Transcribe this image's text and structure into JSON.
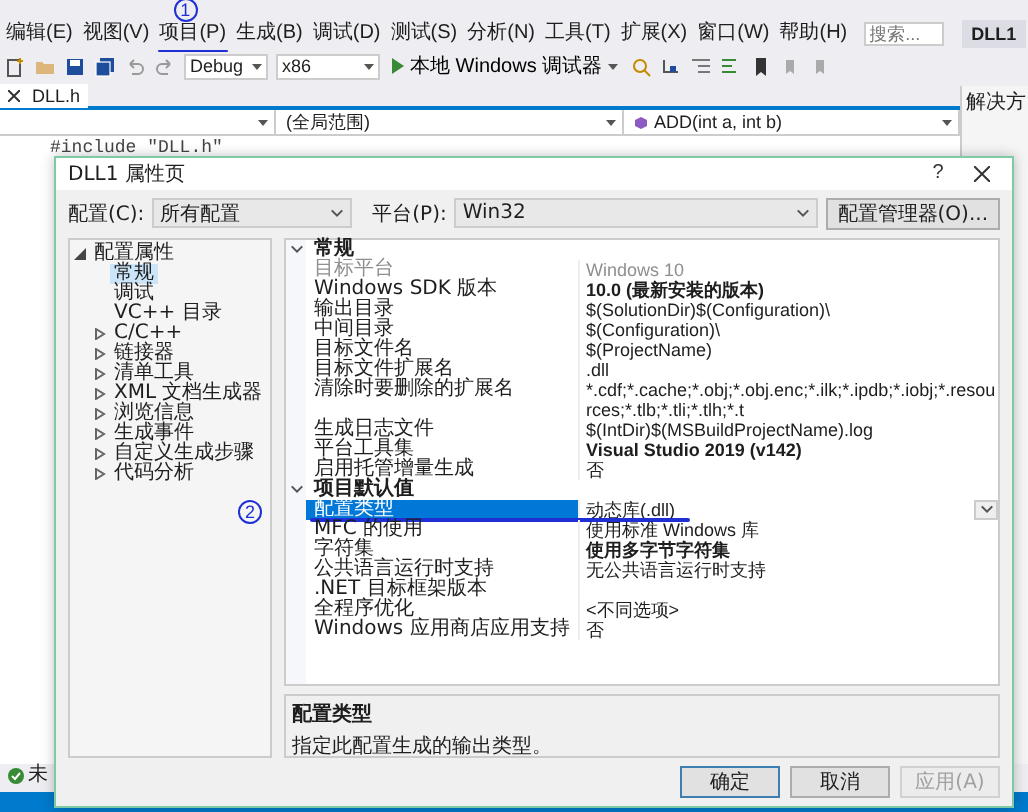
{
  "menu_bar": {
    "items": [
      {
        "label": "编辑(E)"
      },
      {
        "label": "视图(V)"
      },
      {
        "label": "项目(P)",
        "mark": "1"
      },
      {
        "label": "生成(B)"
      },
      {
        "label": "调试(D)"
      },
      {
        "label": "测试(S)"
      },
      {
        "label": "分析(N)"
      },
      {
        "label": "工具(T)"
      },
      {
        "label": "扩展(X)"
      },
      {
        "label": "窗口(W)"
      },
      {
        "label": "帮助(H)"
      }
    ],
    "search": {
      "placeholder": "搜索..."
    },
    "project": "DLL1"
  },
  "toolbar": {
    "configuration": "Debug",
    "platform": "x86",
    "run_button": "本地 Windows 调试器"
  },
  "editor": {
    "tab": "DLL.h",
    "scope": "(全局范围)",
    "member": "ADD(int a, int b)",
    "code_line": "#include \"DLL.h\""
  },
  "side_panel": {
    "title": "解决方"
  },
  "status_bar": {
    "text": "未"
  },
  "dialog": {
    "title": "DLL1 属性页",
    "help": "?",
    "config_label": "配置(C):",
    "config_value": "所有配置",
    "platform_label": "平台(P):",
    "platform_value": "Win32",
    "manager_button": "配置管理器(O)...",
    "tree": [
      {
        "label": "配置属性",
        "kind": "group",
        "expanded": true,
        "selected": false,
        "children": [
          {
            "label": "常规",
            "kind": "page",
            "selected": true
          },
          {
            "label": "调试",
            "kind": "page",
            "selected": false
          },
          {
            "label": "VC++ 目录",
            "kind": "page",
            "selected": false
          },
          {
            "label": "C/C++",
            "kind": "group",
            "expanded": false,
            "selected": false
          },
          {
            "label": "链接器",
            "kind": "group",
            "expanded": false,
            "selected": false
          },
          {
            "label": "清单工具",
            "kind": "group",
            "expanded": false,
            "selected": false
          },
          {
            "label": "XML 文档生成器",
            "kind": "group",
            "expanded": false,
            "selected": false
          },
          {
            "label": "浏览信息",
            "kind": "group",
            "expanded": false,
            "selected": false
          },
          {
            "label": "生成事件",
            "kind": "group",
            "expanded": false,
            "selected": false
          },
          {
            "label": "自定义生成步骤",
            "kind": "group",
            "expanded": false,
            "selected": false
          },
          {
            "label": "代码分析",
            "kind": "group",
            "expanded": false,
            "selected": false
          }
        ]
      }
    ],
    "sections": [
      {
        "title": "常规",
        "expanded": true,
        "rows": [
          {
            "name": "目标平台",
            "value": "Windows 10",
            "disabled": true,
            "modified": false,
            "selected": false
          },
          {
            "name": "Windows SDK 版本",
            "value": "10.0 (最新安装的版本)",
            "disabled": false,
            "modified": true,
            "selected": false
          },
          {
            "name": "输出目录",
            "value": "$(SolutionDir)$(Configuration)\\",
            "disabled": false,
            "modified": false,
            "selected": false
          },
          {
            "name": "中间目录",
            "value": "$(Configuration)\\",
            "disabled": false,
            "modified": false,
            "selected": false
          },
          {
            "name": "目标文件名",
            "value": "$(ProjectName)",
            "disabled": false,
            "modified": false,
            "selected": false
          },
          {
            "name": "目标文件扩展名",
            "value": ".dll",
            "disabled": false,
            "modified": false,
            "selected": false
          },
          {
            "name": "清除时要删除的扩展名",
            "value": "*.cdf;*.cache;*.obj;*.obj.enc;*.ilk;*.ipdb;*.iobj;*.resources;*.tlb;*.tli;*.tlh;*.t",
            "disabled": false,
            "modified": false,
            "selected": false
          },
          {
            "name": "生成日志文件",
            "value": "$(IntDir)$(MSBuildProjectName).log",
            "disabled": false,
            "modified": false,
            "selected": false
          },
          {
            "name": "平台工具集",
            "value": "Visual Studio 2019 (v142)",
            "disabled": false,
            "modified": true,
            "selected": false
          },
          {
            "name": "启用托管增量生成",
            "value": "否",
            "disabled": false,
            "modified": false,
            "selected": false
          }
        ]
      },
      {
        "title": "项目默认值",
        "expanded": true,
        "rows": [
          {
            "name": "配置类型",
            "value": "动态库(.dll)",
            "disabled": false,
            "modified": false,
            "selected": true,
            "mark": "2"
          },
          {
            "name": "MFC 的使用",
            "value": "使用标准 Windows 库",
            "disabled": false,
            "modified": false,
            "selected": false
          },
          {
            "name": "字符集",
            "value": "使用多字节字符集",
            "disabled": false,
            "modified": true,
            "selected": false
          },
          {
            "name": "公共语言运行时支持",
            "value": "无公共语言运行时支持",
            "disabled": false,
            "modified": false,
            "selected": false
          },
          {
            "name": ".NET 目标框架版本",
            "disabled": false,
            "selected": false
          },
          {
            "name": "全程序优化",
            "value": "<不同选项>",
            "disabled": false,
            "modified": false,
            "selected": false
          },
          {
            "name": "Windows 应用商店应用支持",
            "value": "否",
            "disabled": false,
            "modified": false,
            "selected": false
          }
        ]
      }
    ],
    "description": {
      "title": "配置类型",
      "text": "指定此配置生成的输出类型。"
    },
    "buttons": [
      {
        "label": "确定",
        "default": true,
        "disabled": false
      },
      {
        "label": "取消",
        "default": false,
        "disabled": false
      },
      {
        "label": "应用(A)",
        "default": false,
        "disabled": true
      }
    ]
  }
}
